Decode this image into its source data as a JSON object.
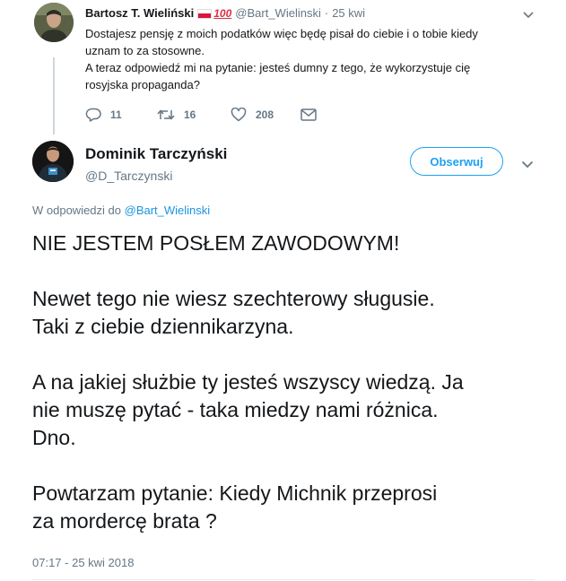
{
  "reply": {
    "name": "Bartosz T. Wieliński",
    "badge_emoji": "💯",
    "handle": "@Bart_Wielinski",
    "separator": "·",
    "time": "25 kwi",
    "lines": [
      "Dostajesz pensję z moich podatków więc będę pisał do ciebie i o tobie kiedy",
      "uznam to za stosowne.",
      "A teraz odpowiedź mi na pytanie: jesteś dumny z tego, że wykorzystuje cię",
      "rosyjska propaganda?"
    ],
    "actions": {
      "replies": "11",
      "retweets": "16",
      "likes": "208"
    },
    "caret_icon": "chevron-down-icon"
  },
  "tweet": {
    "name": "Dominik Tarczyński",
    "handle": "@D_Tarczynski",
    "follow_label": "Obserwuj",
    "in_reply_prefix": "W odpowiedzi do",
    "in_reply_mention": "@Bart_Wielinski",
    "paragraphs": [
      [
        "NIE JESTEM POSŁEM ZAWODOWYM!"
      ],
      [
        "Newet tego nie wiesz szechterowy sługusie.",
        "Taki z ciebie dziennikarzyna."
      ],
      [
        "A na jakiej służbie ty jesteś wszyscy wiedzą. Ja",
        "nie muszę pytać - taka miedzy nami różnica.",
        "Dno."
      ],
      [
        "Powtarzam pytanie: Kiedy Michnik przeprosi",
        "za mordercę brata ?"
      ]
    ],
    "timestamp": "07:17 - 25 kwi 2018"
  },
  "colors": {
    "accent": "#1da1f2",
    "link": "#1b95e0",
    "muted": "#657786",
    "text": "#14171a",
    "thread_line": "#ccd6dd"
  }
}
